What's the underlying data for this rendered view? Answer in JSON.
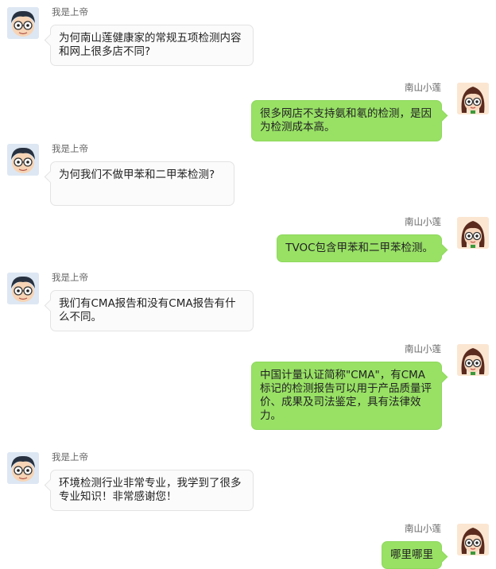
{
  "messages": [
    {
      "sender": "我是上帝",
      "side": "left",
      "text": "为何南山莲健康家的常规五项检测内容和网上很多店不同?"
    },
    {
      "sender": "南山小莲",
      "side": "right",
      "text": "很多网店不支持氨和氡的检测，是因为检测成本高。"
    },
    {
      "sender": "我是上帝",
      "side": "left",
      "text": "为何我们不做甲苯和二甲苯检测?"
    },
    {
      "sender": "南山小莲",
      "side": "right",
      "text": "TVOC包含甲苯和二甲苯检测。"
    },
    {
      "sender": "我是上帝",
      "side": "left",
      "text": "我们有CMA报告和没有CMA报告有什么不同。"
    },
    {
      "sender": "南山小莲",
      "side": "right",
      "text": "中国计量认证简称\"CMA\"，有CMA标记的检测报告可以用于产品质量评价、成果及司法鉴定，具有法律效力。"
    },
    {
      "sender": "我是上帝",
      "side": "left",
      "text": "环境检测行业非常专业，我学到了很多专业知识！非常感谢您！"
    },
    {
      "sender": "南山小莲",
      "side": "right",
      "text": "哪里哪里"
    }
  ],
  "colors": {
    "right_bubble": "#98e165",
    "left_bubble": "#fbfbfb",
    "name_text": "#666666"
  },
  "avatars": {
    "left": "boy-cartoon-avatar-icon",
    "right": "girl-cartoon-avatar-icon"
  }
}
